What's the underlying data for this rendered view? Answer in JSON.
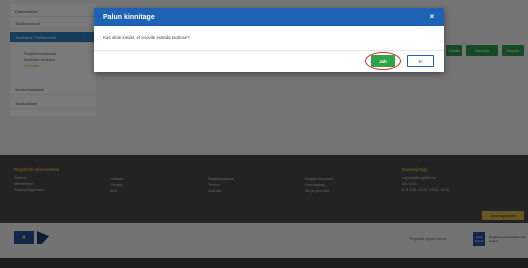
{
  "sidebar": {
    "items": [
      {
        "label": "Dokumendid"
      },
      {
        "label": "Taotlusvoorud"
      },
      {
        "label": "Taotlused / Petitsioonid"
      },
      {
        "label": "Seotud toetused"
      },
      {
        "label": "Taotlustused"
      }
    ],
    "sub_items": [
      {
        "label": "Registrimuudatused"
      },
      {
        "label": "Muutmise taotlused"
      },
      {
        "label": "Taotlused"
      }
    ]
  },
  "content": {
    "buttons": [
      {
        "label": "Kinnita"
      },
      {
        "label": "Salvesta"
      },
      {
        "label": "Kustuta"
      }
    ]
  },
  "footer": {
    "col1": {
      "heading": "Registrite Infosüsteem",
      "lines": [
        "Juhend",
        "Meetmetest",
        "Kasutustingimused"
      ]
    },
    "col2": {
      "lines": [
        "Uudised",
        "Tööaeg",
        "KKK"
      ]
    },
    "col3": {
      "lines": [
        "Registriosakond",
        "Telefon",
        "Aadress"
      ]
    },
    "col4": {
      "lines": [
        "Registri teenused",
        "Kasutajatugi",
        "Abi ja juhendid"
      ]
    },
    "col5": {
      "heading": "Kasutajatugi",
      "lines": [
        "registrid@registrid.ee",
        "611 6000",
        "E-R 9:00–12:00, 13:00–16:00"
      ]
    },
    "feedback_button": "Anna tagasisidet",
    "bottom_text": "Registrite registri teenus",
    "logo3_text": "Eesti Tulevik",
    "logo3_caption": "Registrite ja infosüsteemide keskus"
  },
  "modal": {
    "title": "Palun kinnitage",
    "close_glyph": "×",
    "message": "Kas olete kindel, et soovite esitada taotluse?",
    "yes_label": "Jah",
    "no_label": "Ei"
  },
  "colors": {
    "header": "#1e62b6",
    "yes": "#2fa34c",
    "ring": "#d9342b"
  }
}
